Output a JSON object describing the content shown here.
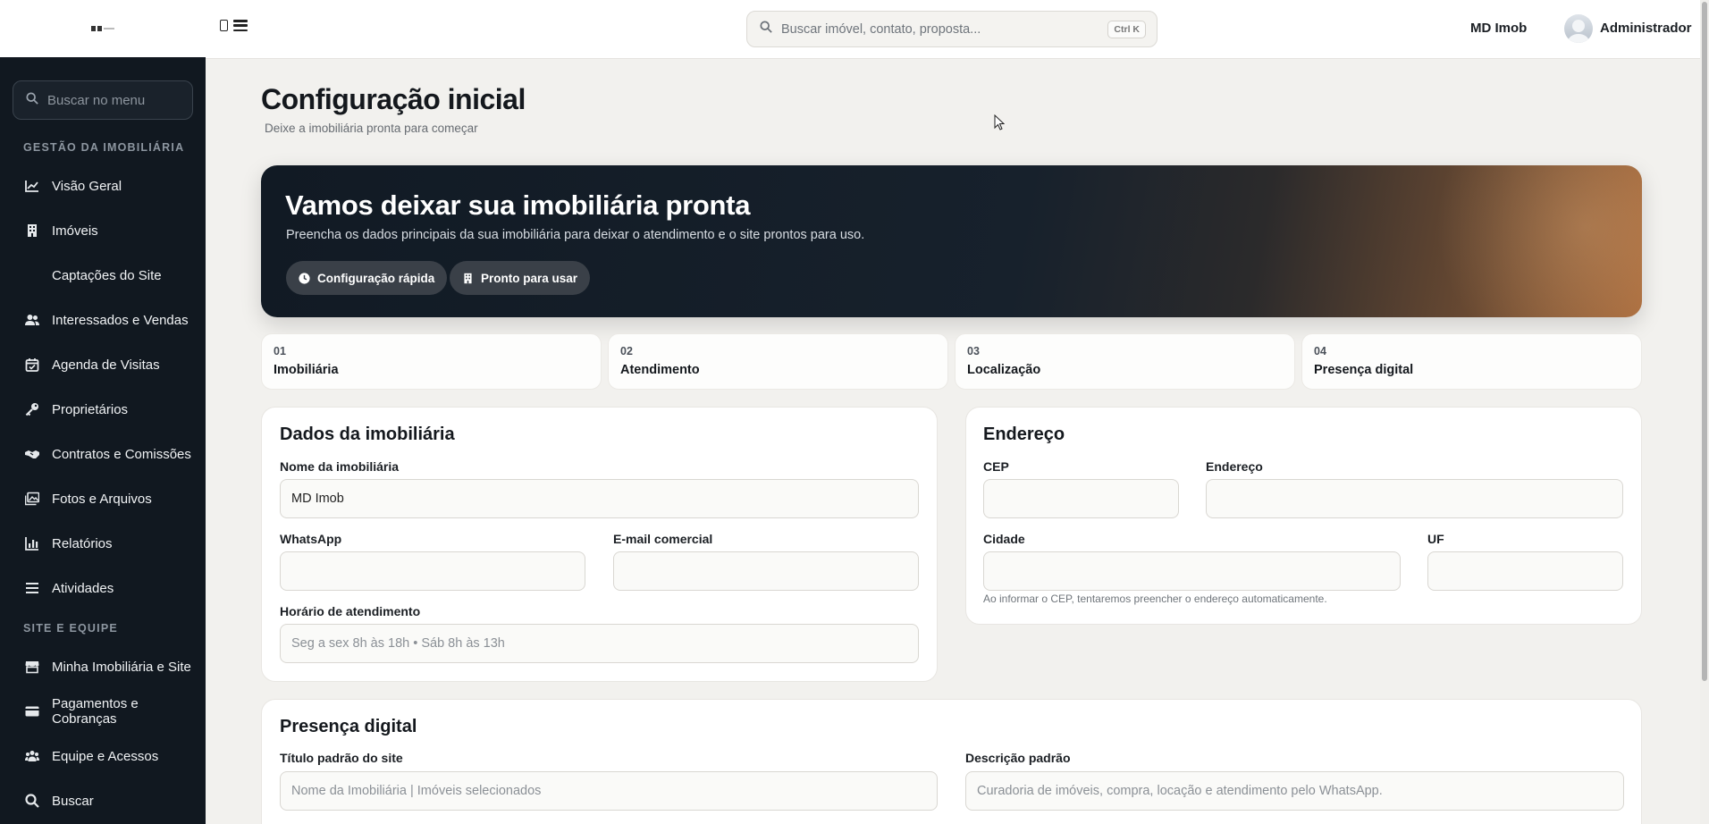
{
  "topbar": {
    "search_placeholder": "Buscar imóvel, contato, proposta...",
    "search_shortcut": "Ctrl K",
    "company_name": "MD Imob",
    "user_name": "Administrador"
  },
  "sidebar": {
    "search_placeholder": "Buscar no menu",
    "sections": [
      {
        "label": "GESTÃO DA IMOBILIÁRIA",
        "items": [
          {
            "label": "Visão Geral",
            "icon": "chart-line-icon"
          },
          {
            "label": "Imóveis",
            "icon": "building-icon"
          },
          {
            "label": "Captações do Site",
            "icon": ""
          },
          {
            "label": "Interessados e Vendas",
            "icon": "users-icon"
          },
          {
            "label": "Agenda de Visitas",
            "icon": "calendar-icon"
          },
          {
            "label": "Proprietários",
            "icon": "key-icon"
          },
          {
            "label": "Contratos e Comissões",
            "icon": "handshake-icon"
          },
          {
            "label": "Fotos e Arquivos",
            "icon": "images-icon"
          },
          {
            "label": "Relatórios",
            "icon": "bar-chart-icon"
          },
          {
            "label": "Atividades",
            "icon": "list-icon"
          }
        ]
      },
      {
        "label": "SITE E EQUIPE",
        "items": [
          {
            "label": "Minha Imobiliária e Site",
            "icon": "store-icon"
          },
          {
            "label": "Pagamentos e Cobranças",
            "icon": "credit-card-icon"
          },
          {
            "label": "Equipe e Acessos",
            "icon": "team-icon"
          },
          {
            "label": "Buscar",
            "icon": "search-icon"
          }
        ]
      }
    ]
  },
  "page": {
    "title": "Configuração inicial",
    "subtitle": "Deixe a imobiliária pronta para começar"
  },
  "hero": {
    "title": "Vamos deixar sua imobiliária pronta",
    "subtitle": "Preencha os dados principais da sua imobiliária para deixar o atendimento e o site prontos para uso.",
    "pills": [
      "Configuração rápida",
      "Pronto para usar"
    ]
  },
  "steps": [
    {
      "num": "01",
      "label": "Imobiliária"
    },
    {
      "num": "02",
      "label": "Atendimento"
    },
    {
      "num": "03",
      "label": "Localização"
    },
    {
      "num": "04",
      "label": "Presença digital"
    }
  ],
  "dados": {
    "title": "Dados da imobiliária",
    "nome_label": "Nome da imobiliária",
    "nome_value": "MD Imob",
    "whatsapp_label": "WhatsApp",
    "email_label": "E-mail comercial",
    "horario_label": "Horário de atendimento",
    "horario_placeholder": "Seg a sex 8h às 18h • Sáb 8h às 13h"
  },
  "endereco": {
    "title": "Endereço",
    "cep_label": "CEP",
    "endereco_label": "Endereço",
    "cidade_label": "Cidade",
    "uf_label": "UF",
    "hint": "Ao informar o CEP, tentaremos preencher o endereço automaticamente."
  },
  "presenca": {
    "title": "Presença digital",
    "titulo_label": "Título padrão do site",
    "titulo_placeholder": "Nome da Imobiliária | Imóveis selecionados",
    "descricao_label": "Descrição padrão",
    "descricao_placeholder": "Curadoria de imóveis, compra, locação e atendimento pelo WhatsApp."
  }
}
